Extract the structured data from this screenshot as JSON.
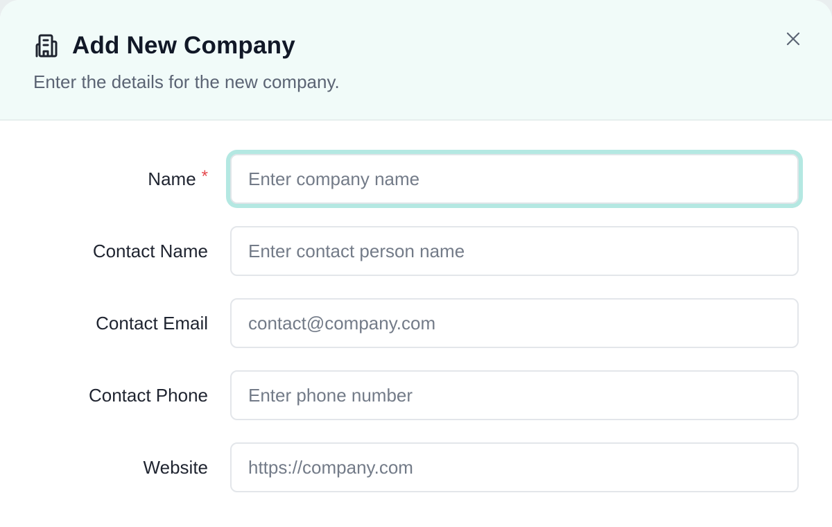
{
  "dialog": {
    "title": "Add New Company",
    "subtitle": "Enter the details for the new company.",
    "icon": "building-icon",
    "close_icon": "close-icon"
  },
  "form": {
    "fields": [
      {
        "label": "Name",
        "required": true,
        "placeholder": "Enter company name",
        "value": "",
        "focused": true
      },
      {
        "label": "Contact Name",
        "required": false,
        "placeholder": "Enter contact person name",
        "value": ""
      },
      {
        "label": "Contact Email",
        "required": false,
        "placeholder": "contact@company.com",
        "value": ""
      },
      {
        "label": "Contact Phone",
        "required": false,
        "placeholder": "Enter phone number",
        "value": ""
      },
      {
        "label": "Website",
        "required": false,
        "placeholder": "https://company.com",
        "value": ""
      }
    ],
    "required_marker": "*"
  },
  "colors": {
    "header_bg": "#f1fbf9",
    "focus_ring": "#b4e8e2",
    "required": "#e5484d",
    "title": "#111827"
  }
}
